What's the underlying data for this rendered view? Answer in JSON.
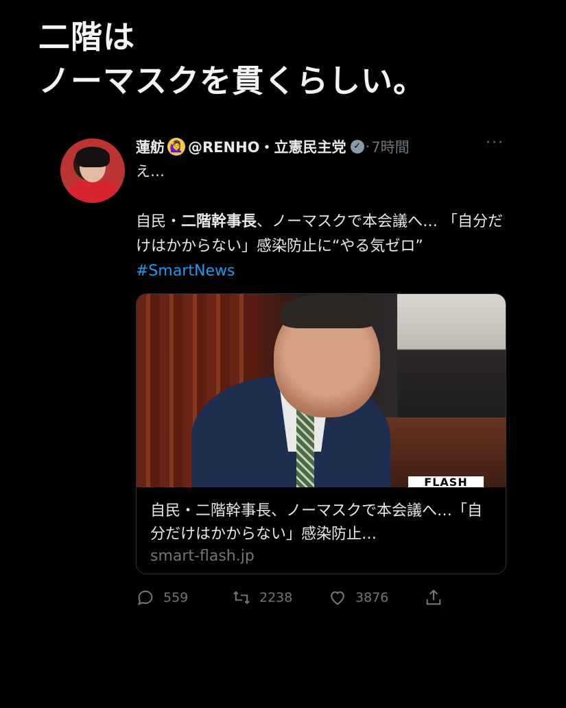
{
  "headline": {
    "line1": "二階は",
    "line2": "ノーマスクを貫くらしい。"
  },
  "tweet": {
    "author_name": "蓮舫",
    "emoji": "🙋‍♀️",
    "handle": "@RENHO・立憲民主党",
    "separator": "·",
    "time": "7時間",
    "more": "···",
    "reply_text": "え…",
    "text_part1": "自民・",
    "text_bold": "二階幹事長",
    "text_part2": "、ノーマスクで本会議へ… 「自分だけはかからない」感染防止に“やる気ゼロ” ",
    "hashtag": "#SmartNews",
    "card": {
      "title": "自民・二階幹事長、ノーマスクで本会議へ…「自分だけはかからない」感染防止…",
      "domain": "smart-flash.jp",
      "image_watermark": "FLASH"
    },
    "counts": {
      "replies": "559",
      "retweets": "2238",
      "likes": "3876"
    }
  },
  "icons": {
    "reply": "reply-icon",
    "retweet": "retweet-icon",
    "like": "heart-icon",
    "share": "share-icon",
    "verified": "verified-badge-icon"
  },
  "colors": {
    "background": "#000000",
    "text": "#e7e9ea",
    "muted": "#71767b",
    "link": "#1d9bf0"
  }
}
